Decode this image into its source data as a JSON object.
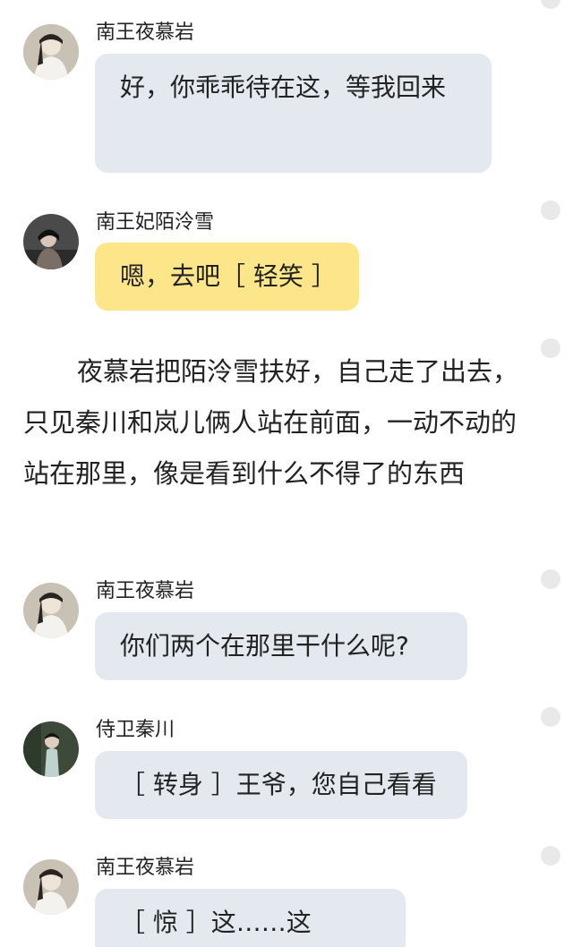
{
  "messages": [
    {
      "sender": "南王夜慕岩",
      "text": "好，你乖乖待在这，等我回来",
      "avatar": "prince-avatar"
    },
    {
      "sender": "南王妃陌泠雪",
      "text": "嗯，去吧［ 轻笑 ］",
      "avatar": "princess-avatar"
    },
    {
      "sender": "南王夜慕岩",
      "text": "你们两个在那里干什么呢?",
      "avatar": "prince-avatar"
    },
    {
      "sender": "侍卫秦川",
      "text": "［ 转身 ］王爷，您自己看看",
      "avatar": "guard-avatar"
    },
    {
      "sender": "南王夜慕岩",
      "text": "［ 惊 ］这……这是……?",
      "avatar": "prince-avatar"
    }
  ],
  "narration": "夜慕岩把陌泠雪扶好，自己走了出去，只见秦川和岚儿俩人站在前面，一动不动的站在那里，像是看到什么不得了的东西",
  "colors": {
    "bubble_default": "#e4e9f0",
    "bubble_highlight": "#fde68a",
    "text": "#222222",
    "side_dot": "#e9e9e9"
  }
}
